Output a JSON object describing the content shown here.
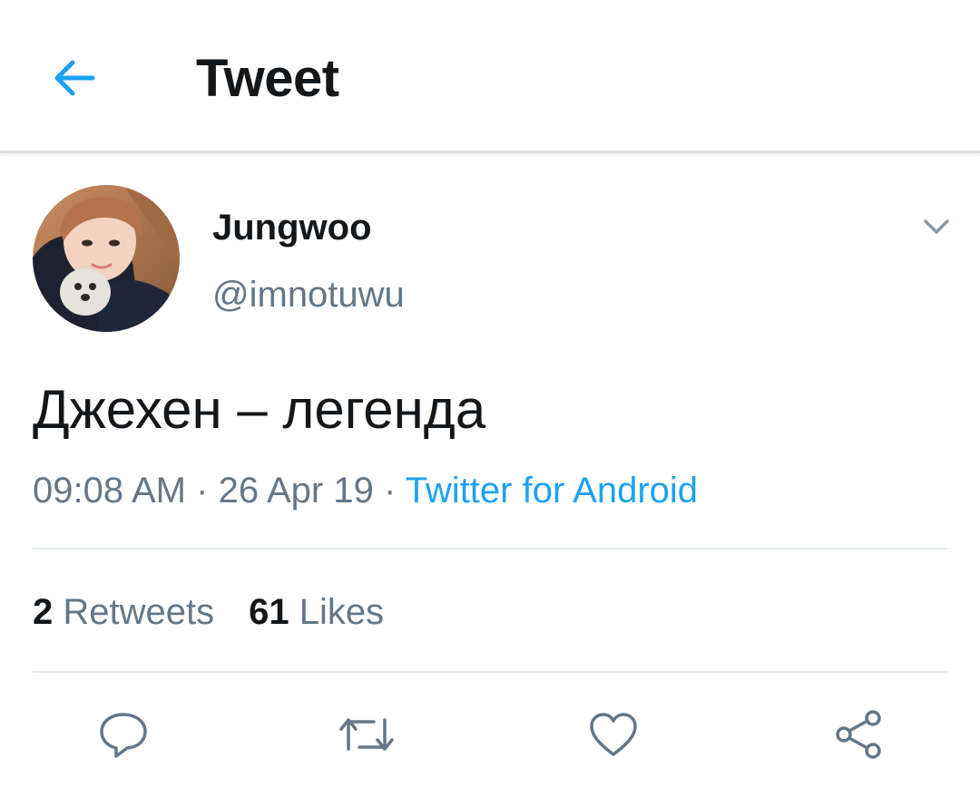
{
  "header": {
    "back_icon": "arrow-left-icon",
    "title": "Tweet"
  },
  "tweet": {
    "author": {
      "display_name": "Jungwoo",
      "handle": "@imnotuwu",
      "avatar": "profile-photo"
    },
    "menu_icon": "chevron-down-icon",
    "text": "Джехен – легенда",
    "time": "09:08 AM",
    "date": "26 Apr 19",
    "separator": "·",
    "source": "Twitter for Android",
    "stats": {
      "retweets_count": "2",
      "retweets_label": "Retweets",
      "likes_count": "61",
      "likes_label": "Likes"
    },
    "actions": [
      {
        "icon": "reply-icon"
      },
      {
        "icon": "retweet-icon"
      },
      {
        "icon": "heart-icon"
      },
      {
        "icon": "share-icon"
      }
    ]
  },
  "colors": {
    "accent": "#1da1f2",
    "text_primary": "#14171a",
    "text_secondary": "#657786",
    "divider": "#e6ecf0"
  }
}
